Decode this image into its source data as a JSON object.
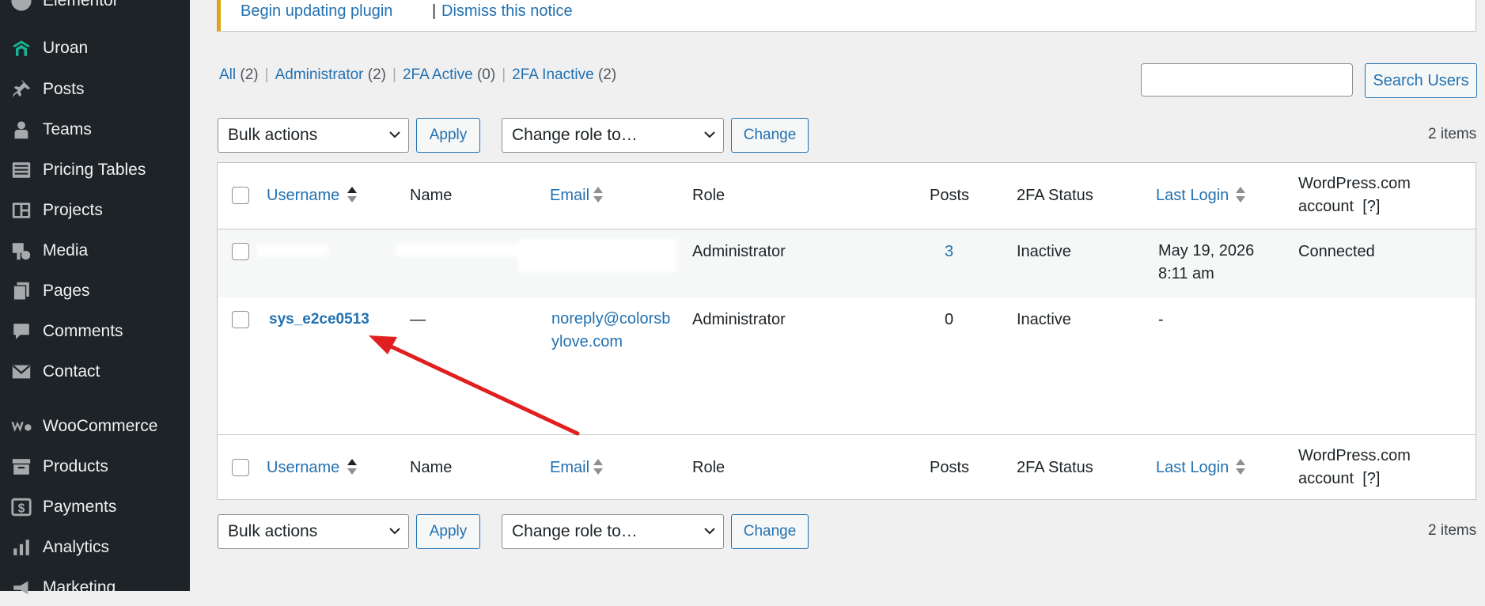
{
  "sidebar": {
    "items": [
      {
        "label": "Elementor",
        "icon": "elementor-icon"
      },
      {
        "label": "Uroan",
        "icon": "uroan-icon"
      },
      {
        "label": "Posts",
        "icon": "pin-icon"
      },
      {
        "label": "Teams",
        "icon": "user-icon"
      },
      {
        "label": "Pricing Tables",
        "icon": "list-icon"
      },
      {
        "label": "Projects",
        "icon": "portfolio-icon"
      },
      {
        "label": "Media",
        "icon": "media-icon"
      },
      {
        "label": "Pages",
        "icon": "pages-icon"
      },
      {
        "label": "Comments",
        "icon": "comment-icon"
      },
      {
        "label": "Contact",
        "icon": "email-icon"
      },
      {
        "label": "WooCommerce",
        "icon": "woo-icon"
      },
      {
        "label": "Products",
        "icon": "archive-icon"
      },
      {
        "label": "Payments",
        "icon": "dollar-icon"
      },
      {
        "label": "Analytics",
        "icon": "chart-bar-icon"
      },
      {
        "label": "Marketing",
        "icon": "megaphone-icon"
      }
    ]
  },
  "notice": {
    "update_link": "Begin updating plugin",
    "separator": "|",
    "dismiss_link": "Dismiss this notice"
  },
  "views": {
    "all": {
      "label": "All",
      "count": "(2)"
    },
    "administrator": {
      "label": "Administrator",
      "count": "(2)"
    },
    "twofa_active": {
      "label": "2FA Active",
      "count": "(0)"
    },
    "twofa_inactive": {
      "label": "2FA Inactive",
      "count": "(2)"
    },
    "pipe": "|"
  },
  "search": {
    "button": "Search Users",
    "value": ""
  },
  "actions": {
    "bulk": "Bulk actions",
    "apply": "Apply",
    "role": "Change role to…",
    "change": "Change",
    "items_count": "2 items"
  },
  "table": {
    "columns": {
      "username": "Username",
      "name": "Name",
      "email": "Email",
      "role": "Role",
      "posts": "Posts",
      "twofa": "2FA Status",
      "last_login": "Last Login",
      "wpcom": "WordPress.com account",
      "wpcom_help": "[?]"
    },
    "rows": [
      {
        "username": "",
        "name": "",
        "email": "",
        "role": "Administrator",
        "posts": "3",
        "twofa": "Inactive",
        "last_login": "May 19, 2026 8:11 am",
        "wpcom": "Connected"
      },
      {
        "username": "sys_e2ce0513",
        "name": "—",
        "email": "noreply@colorsbylove.com",
        "role": "Administrator",
        "posts": "0",
        "twofa": "Inactive",
        "last_login": "-",
        "wpcom": ""
      }
    ]
  },
  "colors": {
    "sidebar_bg": "#1d2327",
    "link": "#2271b1",
    "arrow": "#e02020",
    "notice_border": "#dba617"
  }
}
